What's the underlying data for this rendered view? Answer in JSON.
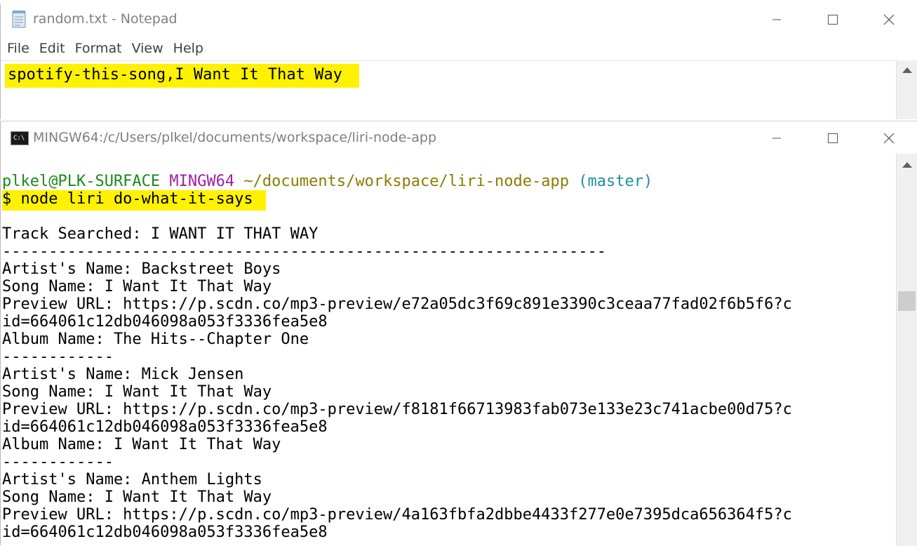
{
  "notepad": {
    "title": "random.txt - Notepad",
    "menu": [
      "File",
      "Edit",
      "Format",
      "View",
      "Help"
    ],
    "content": "spotify-this-song,I Want It That Way"
  },
  "terminal": {
    "title": "MINGW64:/c/Users/plkel/documents/workspace/liri-node-app",
    "prompt_user": "plkel@PLK-SURFACE",
    "prompt_host": "MINGW64",
    "prompt_path": "~/documents/workspace/liri-node-app",
    "prompt_branch": "(master)",
    "command": "$ node liri do-what-it-says",
    "output": [
      "Track Searched: I WANT IT THAT WAY",
      "-----------------------------------------------------------------",
      "Artist's Name: Backstreet Boys",
      "Song Name: I Want It That Way",
      "Preview URL: https://p.scdn.co/mp3-preview/e72a05dc3f69c891e3390c3ceaa77fad02f6b5f6?c",
      "id=664061c12db046098a053f3336fea5e8",
      "Album Name: The Hits--Chapter One",
      "------------",
      "Artist's Name: Mick Jensen",
      "Song Name: I Want It That Way",
      "Preview URL: https://p.scdn.co/mp3-preview/f8181f66713983fab073e133e23c741acbe00d75?c",
      "id=664061c12db046098a053f3336fea5e8",
      "Album Name: I Want It That Way",
      "------------",
      "Artist's Name: Anthem Lights",
      "Song Name: I Want It That Way",
      "Preview URL: https://p.scdn.co/mp3-preview/4a163fbfa2dbbe4433f277e0e7395dca656364f5?c",
      "id=664061c12db046098a053f3336fea5e8"
    ]
  },
  "icons": {
    "notepad": "notepad-icon",
    "terminal": "terminal-icon",
    "minimize": "minimize-icon",
    "maximize": "maximize-icon",
    "close": "close-icon"
  },
  "colors": {
    "highlight": "#fff200",
    "prompt_user": "#1a8a1a",
    "prompt_host": "#a020a0",
    "prompt_path": "#8a7d00",
    "prompt_branch": "#1a8f9f"
  }
}
